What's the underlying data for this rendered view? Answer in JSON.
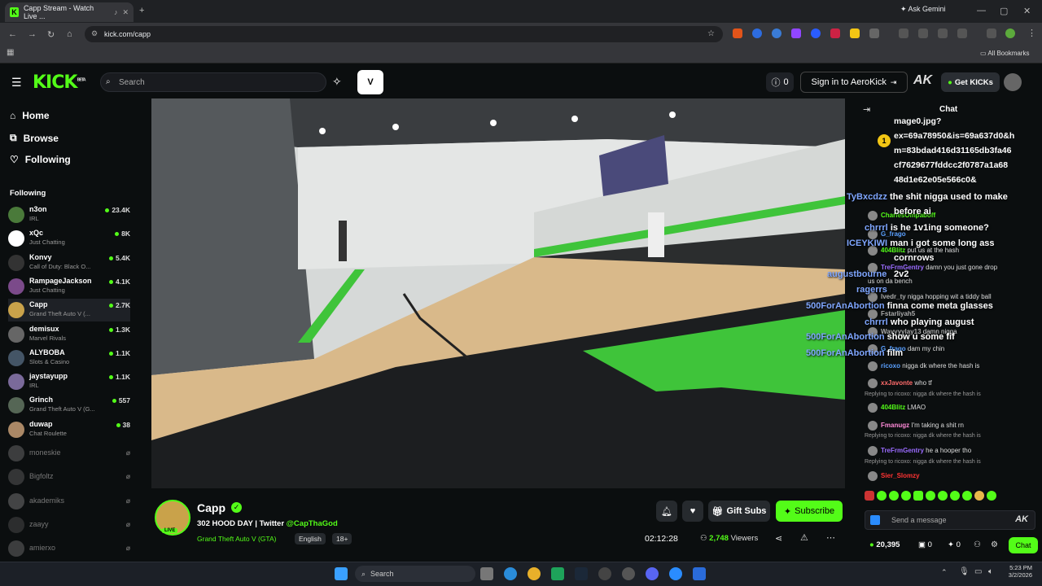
{
  "browser": {
    "tab_title": "Capp Stream - Watch Live ...",
    "url": "kick.com/capp",
    "ask_gemini": "Ask Gemini",
    "all_bookmarks": "All Bookmarks"
  },
  "header": {
    "logo": "KICK",
    "logo_badge": "BETA",
    "search_placeholder": "Search",
    "notif_count": "0",
    "sign_in": "Sign in to AeroKick",
    "get_kicks": "Get KICKs"
  },
  "sidebar": {
    "nav": [
      {
        "label": "Home",
        "icon": "home-icon"
      },
      {
        "label": "Browse",
        "icon": "browse-icon"
      },
      {
        "label": "Following",
        "icon": "heart-icon"
      }
    ],
    "following_title": "Following",
    "channels": [
      {
        "name": "n3on",
        "category": "IRL",
        "viewers": "23.4K",
        "color": "#4a7a3a",
        "live": true
      },
      {
        "name": "xQc",
        "category": "Just Chatting",
        "viewers": "8K",
        "color": "#ffffff",
        "live": true
      },
      {
        "name": "Konvy",
        "category": "Call of Duty: Black O...",
        "viewers": "5.4K",
        "color": "#333333",
        "live": true
      },
      {
        "name": "RampageJackson",
        "category": "Just Chatting",
        "viewers": "4.1K",
        "color": "#7b4a8a",
        "live": true
      },
      {
        "name": "Capp",
        "category": "Grand Theft Auto V (...",
        "viewers": "2.7K",
        "color": "#c9a24a",
        "live": true
      },
      {
        "name": "demisux",
        "category": "Marvel Rivals",
        "viewers": "1.3K",
        "color": "#666666",
        "live": true
      },
      {
        "name": "ALYBOBA",
        "category": "Slots & Casino",
        "viewers": "1.1K",
        "color": "#445566",
        "live": true
      },
      {
        "name": "jaystayupp",
        "category": "IRL",
        "viewers": "1.1K",
        "color": "#7a6a9a",
        "live": true
      },
      {
        "name": "Grinch",
        "category": "Grand Theft Auto V (G...",
        "viewers": "557",
        "color": "#556655",
        "live": true
      },
      {
        "name": "duwap",
        "category": "Chat Roulette",
        "viewers": "38",
        "color": "#aa8866",
        "live": true
      },
      {
        "name": "moneskie",
        "category": "",
        "viewers": "",
        "color": "#777777",
        "live": false
      },
      {
        "name": "Bigfoltz",
        "category": "",
        "viewers": "",
        "color": "#666666",
        "live": false
      },
      {
        "name": "akademiks",
        "category": "",
        "viewers": "",
        "color": "#888888",
        "live": false
      },
      {
        "name": "zaayy",
        "category": "",
        "viewers": "",
        "color": "#555555",
        "live": false
      },
      {
        "name": "amierxo",
        "category": "",
        "viewers": "",
        "color": "#777777",
        "live": false
      }
    ]
  },
  "channel": {
    "name": "Capp",
    "live_badge": "LIVE",
    "title": "302 HOOD DAY | Twitter",
    "twitter": "@CapThaGod",
    "category": "Grand Theft Auto V (GTA)",
    "language": "English",
    "age": "18+",
    "gift_subs": "Gift Subs",
    "subscribe": "Subscribe",
    "uptime": "02:12:28",
    "viewers": "2,748",
    "viewers_label": "Viewers"
  },
  "chat": {
    "title": "Chat",
    "top_text": [
      "mage0.jpg?",
      "ex=69a78950&is=69a637d0&h",
      "m=83bdad416d31165db3fa46",
      "cf7629677fddcc2f0787a1a68",
      "48d1e62e05e566c0&"
    ],
    "overlay_messages": [
      {
        "user": "TyBxcdzz",
        "text": "the shit nigga used to make"
      },
      {
        "user": "",
        "text": "before ai"
      },
      {
        "user": "chrrrl",
        "text": "is he 1v1ing someone?"
      },
      {
        "user": "ICEYKIWI",
        "text": "man i got some long ass"
      },
      {
        "user": "",
        "text": "cornrows"
      },
      {
        "user": "",
        "text": "2v2"
      },
      {
        "user": "augustbourne",
        "text": ""
      },
      {
        "user": "ragerrs",
        "text": ""
      },
      {
        "user": "500ForAnAbortion",
        "text": "finna come meta glasses"
      },
      {
        "user": "chrrrl",
        "text": "who playing august"
      },
      {
        "user": "500ForAnAbortion",
        "text": "show u some fif"
      },
      {
        "user": "500ForAnAbortion",
        "text": "film"
      }
    ],
    "messages": [
      {
        "user": "CharlesOmpaboff",
        "text": "",
        "color": "#53fc18"
      },
      {
        "user": "G_frago",
        "text": "",
        "color": "#5aa0ff"
      },
      {
        "user": "404Blitz",
        "text": "put us at the hash",
        "color": "#53fc18"
      },
      {
        "user": "TreFrmGentry",
        "text": "damn you just gone drop",
        "color": "#9a6bff"
      },
      {
        "user": "",
        "text": "us on da bench",
        "color": "#ddd"
      },
      {
        "user": "lvedr_ty",
        "text": "nigga hopping wit a tiddy ball",
        "color": "#aaa"
      },
      {
        "user": "Fstarliyah5",
        "text": "",
        "color": "#aaa"
      },
      {
        "user": "Wavyyylay13",
        "text": "damn nigga",
        "color": "#aaa"
      },
      {
        "user": "G_frago",
        "text": "dam my chin",
        "color": "#5aa0ff"
      },
      {
        "user": "ricoxo",
        "text": "nigga dk where the hash is",
        "color": "#5aa0ff"
      },
      {
        "user": "xxJavonte",
        "text": "who tf",
        "color": "#ff6b6b"
      },
      {
        "user": "404Blitz",
        "text": "LMAO",
        "color": "#53fc18"
      },
      {
        "user": "Fmanugz",
        "text": "I'm taking a shit rn",
        "color": "#ff8ad8"
      },
      {
        "user": "TreFrmGentry",
        "text": "he a hooper tho",
        "color": "#9a6bff"
      },
      {
        "user": "Sier_Slomzy",
        "text": "",
        "color": "#ff3333"
      }
    ],
    "replies": [
      "Replying to ricoxo: nigga dk where the hash is",
      "Replying to ricoxo: nigga dk where the hash is",
      "Replying to ricoxo: nigga dk where the hash is"
    ],
    "input_placeholder": "Send a message",
    "points": "20,395",
    "stat_a": "0",
    "stat_b": "0",
    "chat_button": "Chat"
  },
  "taskbar": {
    "search": "Search",
    "time": "5:23 PM",
    "date": "3/2/2026"
  }
}
